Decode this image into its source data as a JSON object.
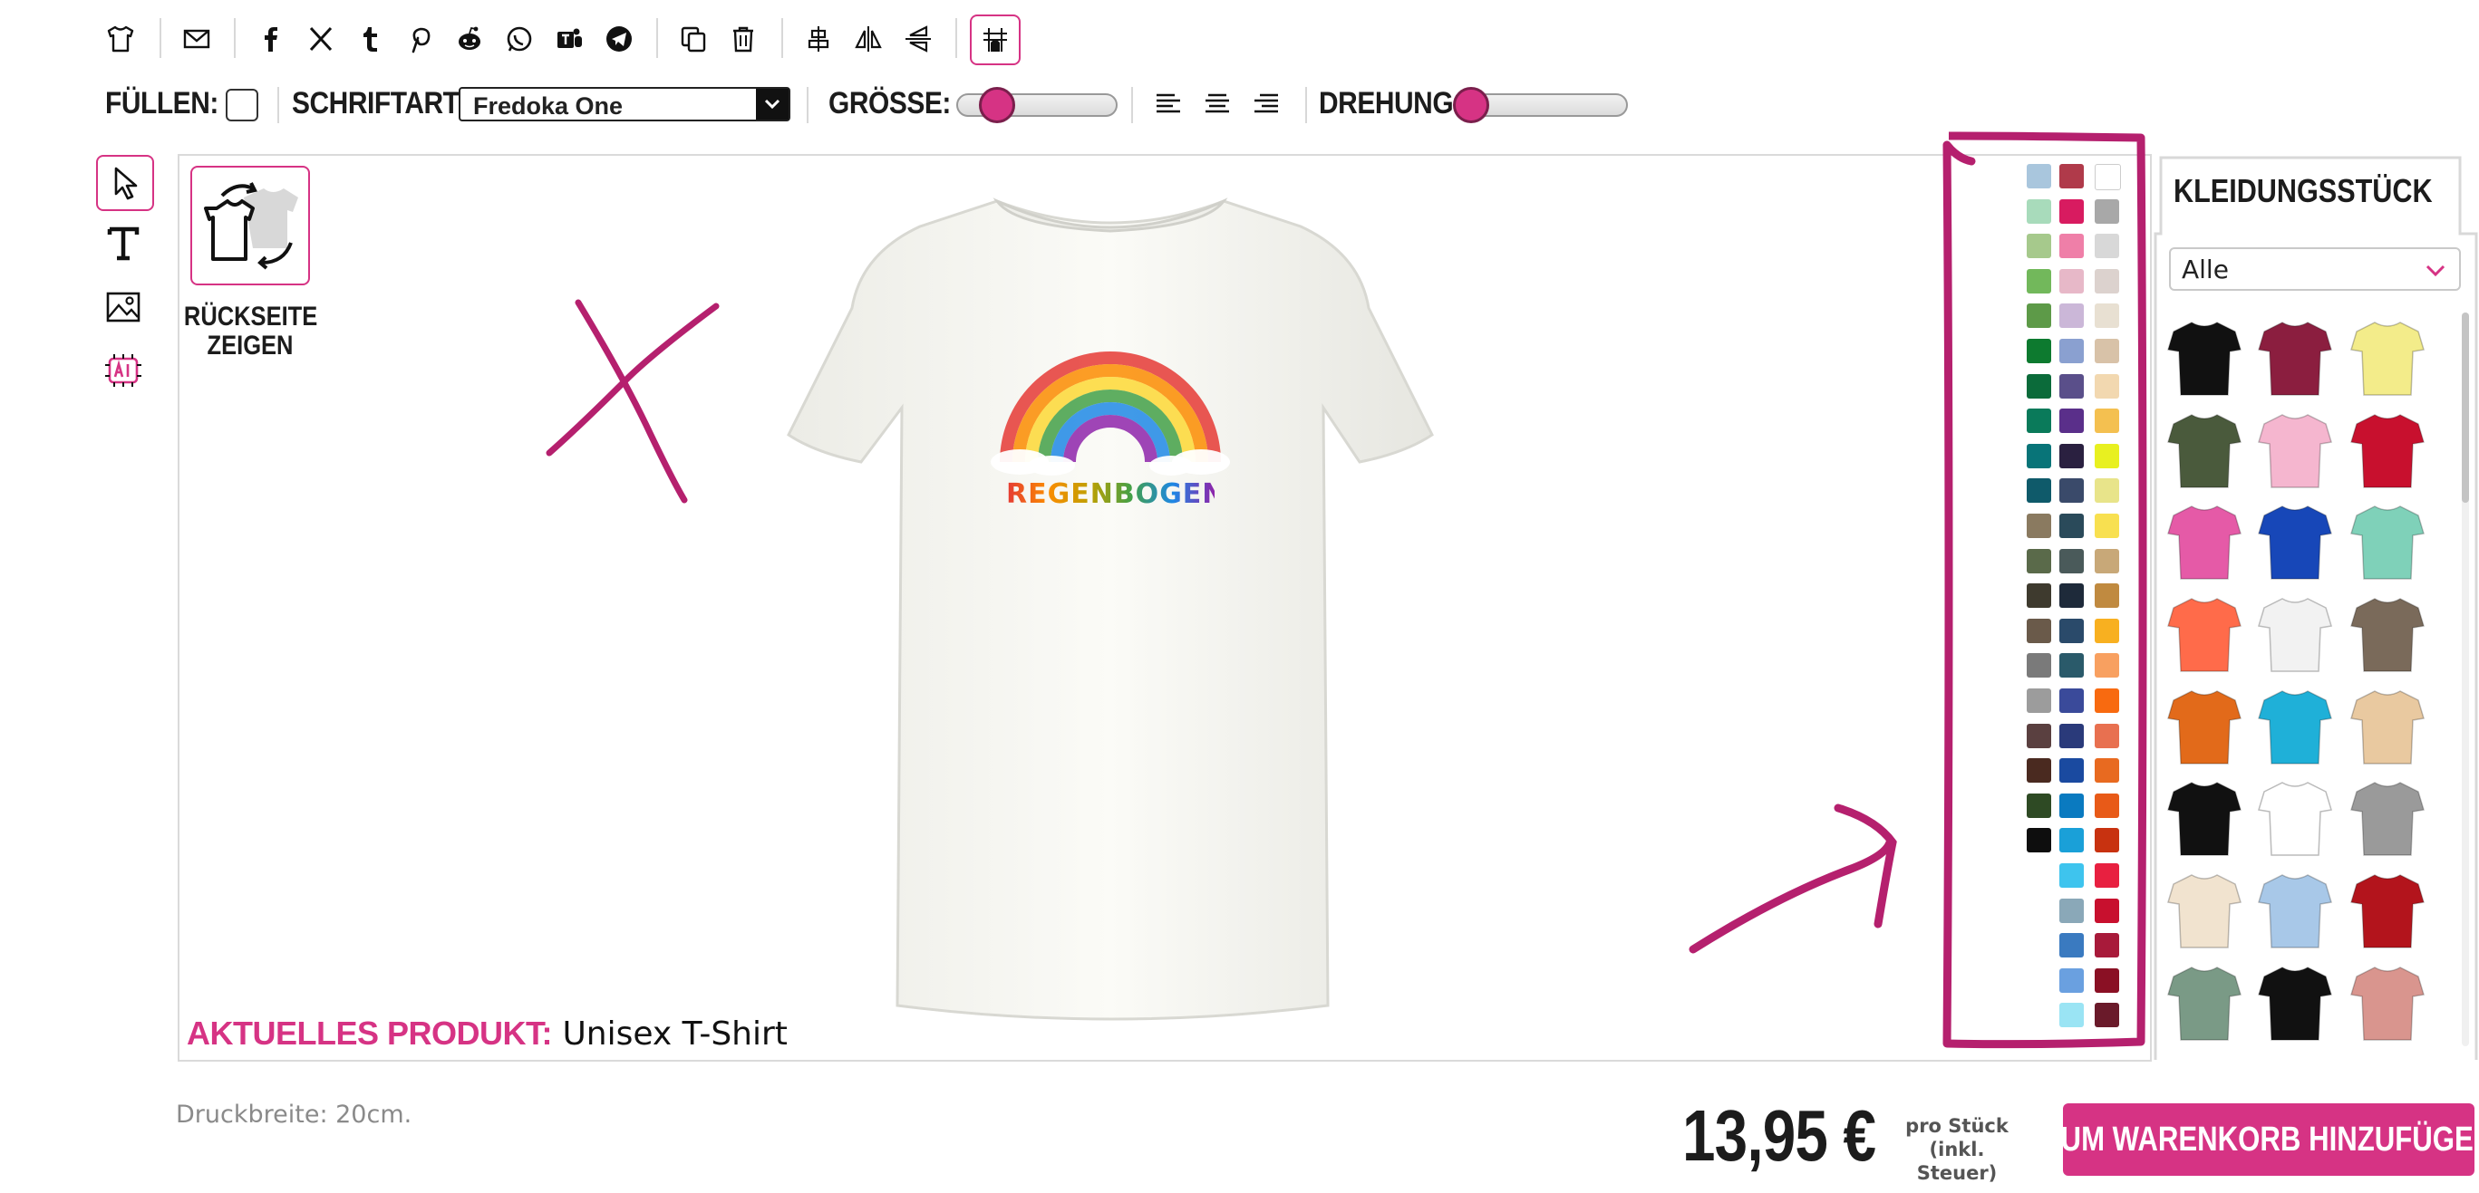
{
  "toolbar": {
    "fill_label": "FÜLLEN:",
    "font_label": "SCHRIFTART:",
    "font_value": "Fredoka One",
    "size_label": "GRÖSSE:",
    "rotation_label": "DREHUNG:"
  },
  "canvas": {
    "back_button_label": "RÜCKSEITE ZEIGEN",
    "design_text": "REGENBOGEN",
    "current_product_key": "AKTUELLES PRODUKT:",
    "current_product_value": "Unisex T-Shirt"
  },
  "garment_panel": {
    "title": "KLEIDUNGSSTÜCK",
    "filter_value": "Alle",
    "colors": [
      "#111111",
      "#8b1e3f",
      "#f3ec8a",
      "#4a5a3c",
      "#f5b6cf",
      "#c8102e",
      "#e55aa7",
      "#1747b8",
      "#7fd1b9",
      "#ff6b4a",
      "#f2f2f2",
      "#7a6a5a",
      "#e26a1a",
      "#1fb0d8",
      "#e9c9a0",
      "#111111",
      "#ffffff",
      "#9a9a9a",
      "#f1e3cf",
      "#a8c8e8",
      "#b3141c",
      "#7a9a86",
      "#111111",
      "#d9958e"
    ]
  },
  "palette": {
    "col1": [
      "#a9c6dd",
      "#a8dbbb",
      "#a6c98c",
      "#72b85b",
      "#5d9a48",
      "#0d7a2f",
      "#0b6b3a",
      "#0a7a5a",
      "#087478",
      "#0f5a6a",
      "#8a7a60",
      "#5a6a4a",
      "#3e3a2e",
      "#6a5a4a",
      "#7a7a7a",
      "#9c9c9c",
      "#5a4040",
      "#4a2a20",
      "#2e4a24",
      "#0e0e0e"
    ],
    "col2": [
      "#b03a4a",
      "#d81b60",
      "#ef7fa8",
      "#e7b8c8",
      "#cbb7d8",
      "#8aa0d0",
      "#5a4f8a",
      "#5a2f8a",
      "#2a2040",
      "#3a4a6a",
      "#2a4a5a",
      "#4a5a5a",
      "#1e2a3a",
      "#2a4a6a",
      "#2a5a6a",
      "#3a4a9a",
      "#2a3a7a",
      "#1a4aa0",
      "#0a7ac0",
      "#1aa0d8",
      "#3ec4ee",
      "#8aa8b8",
      "#3a7ac0",
      "#6aa0e0",
      "#9ae4f4"
    ],
    "col3": [
      "#ffffff",
      "#a8a8a8",
      "#d8d8d8",
      "#dcd2ce",
      "#e8e0d2",
      "#d8c2a8",
      "#f2d8b0",
      "#f4c050",
      "#e8f020",
      "#e8e48a",
      "#f8e050",
      "#c8a878",
      "#c08a40",
      "#f8b020",
      "#f8a060",
      "#f86a10",
      "#e87050",
      "#e86a20",
      "#e85a18",
      "#c83210",
      "#e82040",
      "#c8102e",
      "#a81a3a",
      "#8a1024",
      "#6a1a2a"
    ]
  },
  "bottom": {
    "print_width": "Druckbreite: 20cm.",
    "price": "13,95 €",
    "price_note_1": "pro Stück",
    "price_note_2": "(inkl. Steuer)",
    "cart_button": "ZUM WARENKORB HINZUFÜGEN"
  },
  "colors": {
    "accent": "#d63384",
    "annotation": "#b5206e"
  }
}
